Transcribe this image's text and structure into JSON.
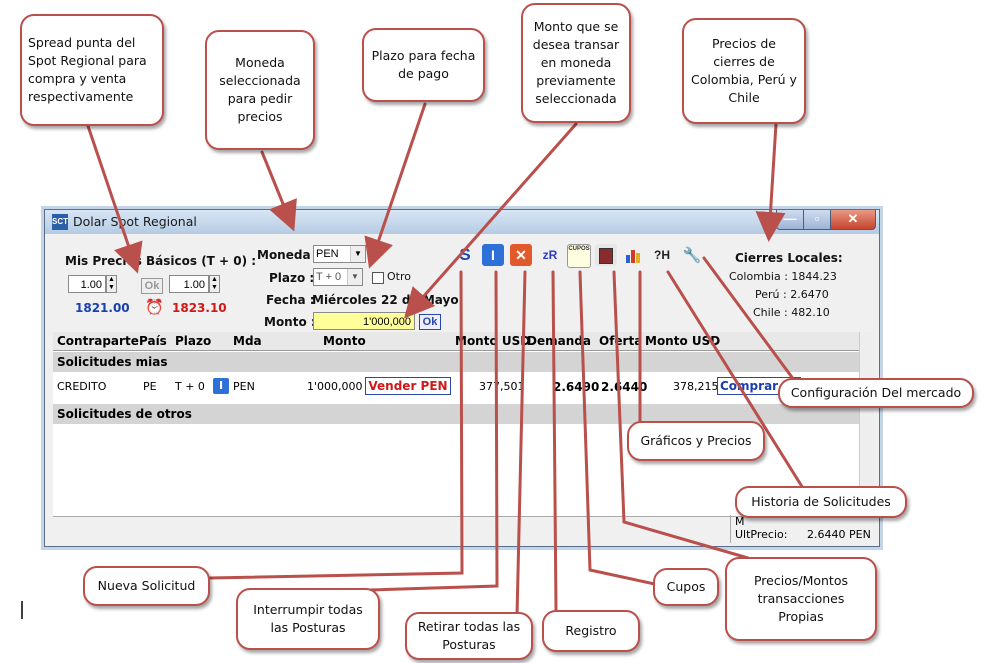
{
  "window": {
    "title": "Dolar Spot Regional",
    "app_icon": "SCT"
  },
  "prices": {
    "title": "Mis Precios Básicos (T + 0) :",
    "bid_spread": "1.00",
    "ask_spread": "1.00",
    "ok": "Ok",
    "bid_price": "1821.00",
    "ask_price": "1823.10"
  },
  "order": {
    "moneda_label": "Moneda :",
    "moneda_value": "PEN",
    "plazo_label": "Plazo :",
    "plazo_value": "T + 0",
    "otro_label": "Otro",
    "fecha_label": "Fecha :",
    "fecha_value": "Miércoles 22 de Mayo",
    "monto_label": "Monto :",
    "monto_value": "1'000,000",
    "ok": "Ok"
  },
  "toolbar": {
    "nueva_glyph": "S",
    "interrumpir_glyph": "I",
    "retirar_glyph": "✕",
    "registro_glyph": "zR",
    "cupos_glyph": "CUPOS",
    "historia_glyph": "?H"
  },
  "cierres": {
    "title": "Cierres Locales:",
    "colombia": "Colombia : 1844.23",
    "peru": "Perú : 2.6470",
    "chile": "Chile : 482.10"
  },
  "grid": {
    "headers": [
      "Contraparte",
      "País",
      "Plazo",
      "Mda",
      "Monto",
      "Monto USD",
      "Demanda",
      "Oferta",
      "Monto USD"
    ],
    "section_mine": "Solicitudes mias",
    "section_others": "Solicitudes de otros",
    "row": {
      "contraparte": "CREDITO",
      "pais": "PE",
      "plazo": "T + 0",
      "badge": "I",
      "mda": "PEN",
      "monto": "1'000,000",
      "action": "Vender PEN",
      "monto_usd": "377,501",
      "demanda": "2.6490",
      "oferta": "2.6440",
      "monto_usd2": "378,215",
      "action2": "Comprar P"
    }
  },
  "status": {
    "label1": "M",
    "label2": "UltPrecio:",
    "value2": "2.6440 PEN"
  },
  "callouts": {
    "spread": "Spread punta del Spot Regional para compra y venta respectivamente",
    "moneda": "Moneda seleccionada para pedir precios",
    "plazo": "Plazo para fecha de pago",
    "monto": "Monto que se desea transar en moneda previamente seleccionada",
    "cierres": "Precios de cierres de Colombia, Perú y Chile",
    "config": "Configuración Del mercado",
    "graficos": "Gráficos y Precios",
    "historia": "Historia de Solicitudes",
    "precios_montos": "Precios/Montos transacciones Propias",
    "cupos": "Cupos",
    "registro": "Registro",
    "retirar": "Retirar todas las Posturas",
    "interrumpir": "Interrumpir todas las Posturas",
    "nueva": "Nueva Solicitud"
  },
  "colors": {
    "callout_border": "#b9504b",
    "bid_blue": "#1a3fb0",
    "ask_red": "#d01818",
    "monto_bg": "#ffff99"
  }
}
